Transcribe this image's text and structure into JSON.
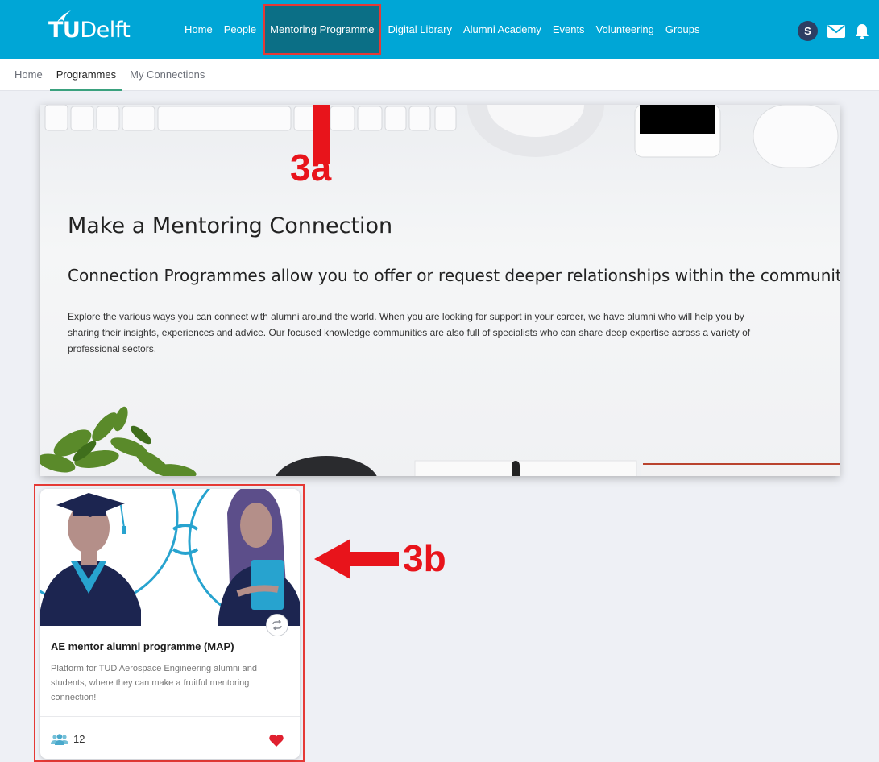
{
  "brand": {
    "logo_bold": "TU",
    "logo_rest": "Delft"
  },
  "nav": {
    "items": [
      "Home",
      "People",
      "Mentoring Programme",
      "Digital Library",
      "Alumni Academy",
      "Events",
      "Volunteering",
      "Groups"
    ],
    "active_index": 2
  },
  "user": {
    "avatar_initial": "S"
  },
  "subnav": {
    "items": [
      "Home",
      "Programmes",
      "My Connections"
    ],
    "active_index": 1
  },
  "hero": {
    "title": "Make a Mentoring Connection",
    "subtitle": "Connection Programmes allow you to offer or request deeper relationships within the community.",
    "body": "Explore the various ways you can connect with alumni around the world. When you are looking for support in your career, we have alumni who will help you by sharing their insights, experiences and advice. Our focused knowledge communities are also full of specialists who can share deep expertise across a variety of professional sectors."
  },
  "card": {
    "title": "AE mentor alumni programme (MAP)",
    "description": "Platform for TUD Aerospace Engineering alumni and students, where they can make a fruitful mentoring connection!",
    "member_count": "12"
  },
  "annotations": {
    "label_a": "3a",
    "label_b": "3b"
  },
  "colors": {
    "nav_bg": "#00a6d6",
    "nav_active_bg": "#0b6f86",
    "annotation_red": "#e8141b",
    "heart_red": "#e0202f",
    "subnav_underline": "#3aa17e"
  }
}
